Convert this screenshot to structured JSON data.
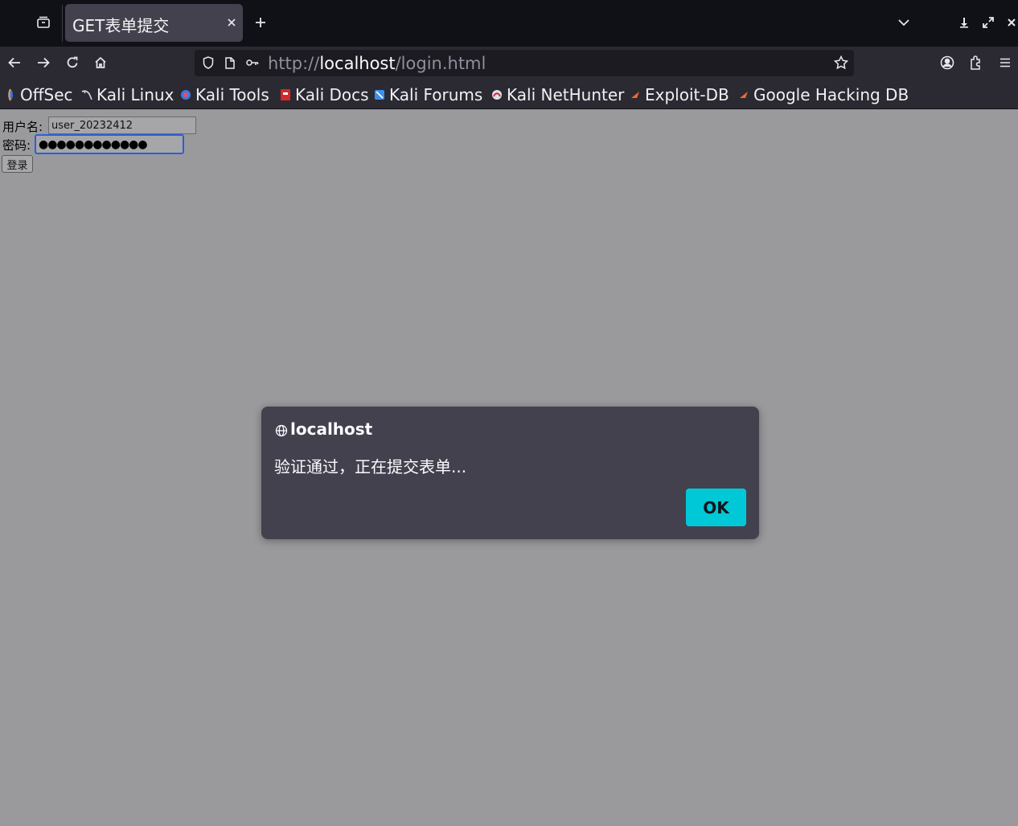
{
  "tabs": {
    "active_title": "GET表单提交"
  },
  "address_bar": {
    "scheme": "http://",
    "host": "localhost",
    "path": "/login.html"
  },
  "bookmarks": [
    {
      "label": "OffSec",
      "icon": "offsec-icon"
    },
    {
      "label": "Kali Linux",
      "icon": "kali-linux-icon"
    },
    {
      "label": "Kali Tools",
      "icon": "kali-tools-icon"
    },
    {
      "label": "Kali Docs",
      "icon": "kali-docs-icon"
    },
    {
      "label": "Kali Forums",
      "icon": "kali-forums-icon"
    },
    {
      "label": "Kali NetHunter",
      "icon": "kali-nethunter-icon"
    },
    {
      "label": "Exploit-DB",
      "icon": "exploit-db-icon"
    },
    {
      "label": "Google Hacking DB",
      "icon": "ghdb-icon"
    }
  ],
  "form": {
    "username_label": "用户名:",
    "username_value": "user_20232412",
    "password_label": "密码:",
    "password_value": "●●●●●●●●●●●●",
    "submit_label": "登录"
  },
  "dialog": {
    "origin": "localhost",
    "message": "验证通过，正在提交表单...",
    "ok_label": "OK"
  },
  "colors": {
    "page_background": "#9a9a9c",
    "toolbar": "#2b2a33",
    "tab_strip": "#0f1117",
    "dialog_background": "#42414d",
    "accent": "#00c8d7"
  }
}
